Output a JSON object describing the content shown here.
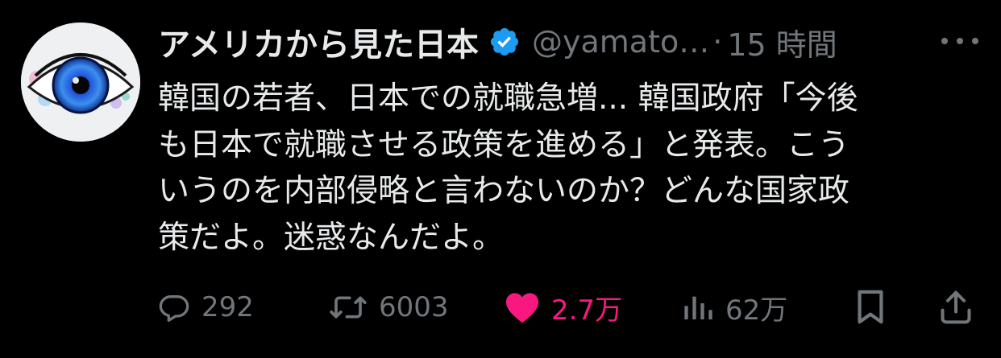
{
  "user": {
    "display_name": "アメリカから見た日本",
    "handle": "@yamato…",
    "separator": "·",
    "time": "15 時間",
    "verified_color": "#1d9bf0"
  },
  "tweet": {
    "lines": [
      "韓国の若者、日本での就職急増... 韓国政府「今後",
      "も日本で就職させる政策を進める」と発表。こう",
      "いうのを内部侵略と言わないのか？どんな国家政",
      "策だよ。迷惑なんだよ。"
    ]
  },
  "actions": {
    "reply_count": "292",
    "retweet_count": "6003",
    "like_count": "2.7万",
    "views_count": "62万",
    "like_color": "#f91880",
    "icons": [
      "reply-icon",
      "retweet-icon",
      "heart-icon",
      "views-icon",
      "bookmark-icon",
      "share-icon"
    ]
  },
  "colors": {
    "background": "#000000",
    "text": "#e7e9ea",
    "muted": "#71767b"
  }
}
